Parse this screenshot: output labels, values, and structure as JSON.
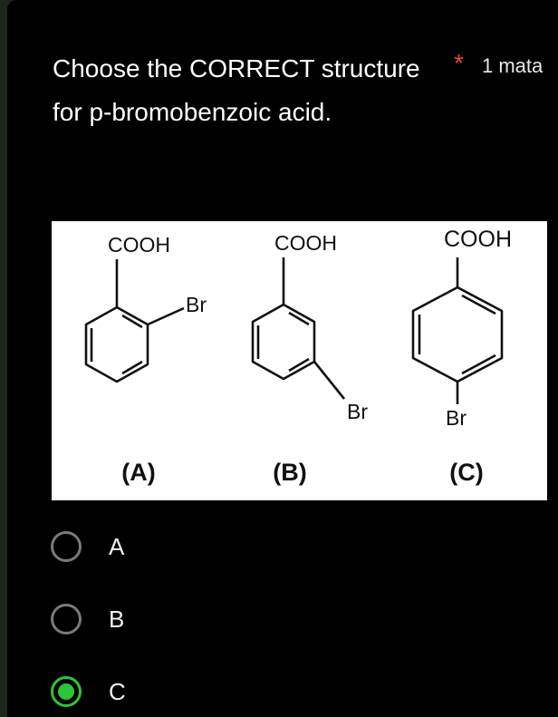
{
  "question": {
    "text": "Choose the CORRECT structure for p-bromobenzoic acid.",
    "required_mark": "*",
    "points": "1 mata"
  },
  "figure": {
    "structures": [
      {
        "top_group": "COOH",
        "substituent": "Br",
        "caption": "(A)"
      },
      {
        "top_group": "COOH",
        "substituent": "Br",
        "caption": "(B)"
      },
      {
        "top_group": "COOH",
        "substituent": "Br",
        "caption": "(C)"
      }
    ]
  },
  "options": [
    {
      "label": "A",
      "selected": false
    },
    {
      "label": "B",
      "selected": false
    },
    {
      "label": "C",
      "selected": true
    }
  ],
  "colors": {
    "selected": "#2ec43a",
    "required": "#e34b42"
  }
}
